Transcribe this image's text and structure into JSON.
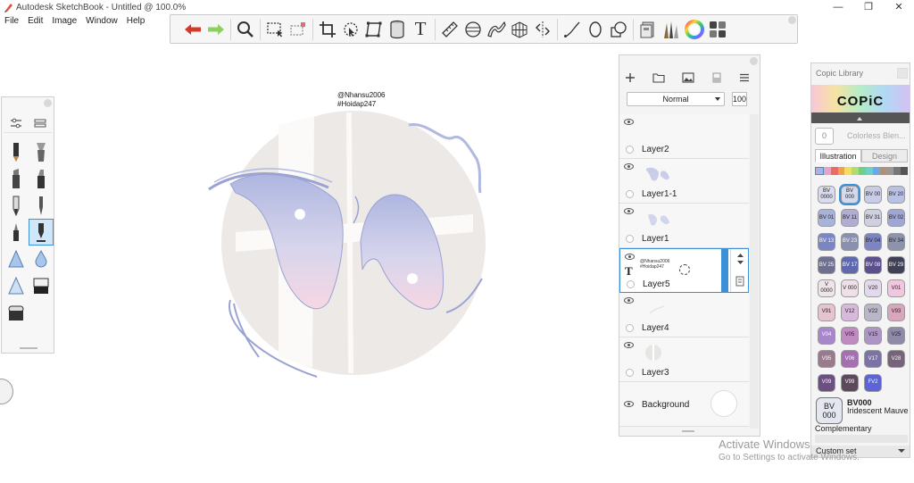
{
  "window": {
    "title": "Autodesk SketchBook - Untitled @ 100.0%",
    "minimize": "—",
    "maximize": "❐",
    "close": "✕"
  },
  "menu": [
    "File",
    "Edit",
    "Image",
    "Window",
    "Help"
  ],
  "toolbar": {
    "tools": [
      "undo-icon",
      "redo-icon",
      "zoom-icon",
      "select-icon",
      "crop-select-icon",
      "crop-icon",
      "lasso-icon",
      "perspective-icon",
      "cylinder-icon",
      "text-icon",
      "ruler-icon",
      "ellipse-guide-icon",
      "french-curve-icon",
      "perspective-grid-icon",
      "symmetry-icon",
      "stroke-icon",
      "circle-icon",
      "shape-icon",
      "copic-library-icon",
      "brush-library-icon",
      "color-wheel-icon",
      "layer-editor-icon"
    ],
    "text_glyph": "T"
  },
  "canvas": {
    "watermark_line1": "@Nhansu2006",
    "watermark_line2": "#Hoidap247"
  },
  "layers": {
    "blend_mode": "Normal",
    "opacity": "100",
    "items": [
      {
        "name": "Layer2"
      },
      {
        "name": "Layer1-1"
      },
      {
        "name": "Layer1"
      },
      {
        "name": "Layer5",
        "active": true,
        "text_line1": "@Nhansu2006",
        "text_line2": "#Hoidap247",
        "type_glyph": "T"
      },
      {
        "name": "Layer4"
      },
      {
        "name": "Layer3"
      },
      {
        "name": "Background"
      }
    ]
  },
  "copic": {
    "title": "Copic Library",
    "logo": "COPiC",
    "colorless_code": "0",
    "colorless_label": "Colorless Blen...",
    "tabs": [
      "Illustration",
      "Design"
    ],
    "swatches": [
      {
        "code": "BV 0000",
        "color": "#d9dcee"
      },
      {
        "code": "BV 000",
        "color": "#d5d9ec",
        "selected": true
      },
      {
        "code": "BV 00",
        "color": "#c9cce6"
      },
      {
        "code": "BV 20",
        "color": "#b9c2e4"
      },
      {
        "code": "BV 01",
        "color": "#a8b3dc"
      },
      {
        "code": "BV 11",
        "color": "#b0acd4"
      },
      {
        "code": "BV 31",
        "color": "#cfcfe2"
      },
      {
        "code": "BV 02",
        "color": "#9fa6d6"
      },
      {
        "code": "BV 13",
        "color": "#7b85c3"
      },
      {
        "code": "BV 23",
        "color": "#8a90b0"
      },
      {
        "code": "BV 04",
        "color": "#7d84c2"
      },
      {
        "code": "BV 34",
        "color": "#8e93ab"
      },
      {
        "code": "BV 25",
        "color": "#6f6f90"
      },
      {
        "code": "BV 17",
        "color": "#5f6aae"
      },
      {
        "code": "BV 08",
        "color": "#5b4f8e"
      },
      {
        "code": "BV 29",
        "color": "#3f3f55"
      },
      {
        "code": "V 0000",
        "color": "#efe4ea"
      },
      {
        "code": "V 000",
        "color": "#eedfe9"
      },
      {
        "code": "V20",
        "color": "#e3d9ec"
      },
      {
        "code": "V01",
        "color": "#f1c6df"
      },
      {
        "code": "V91",
        "color": "#e6c4cf"
      },
      {
        "code": "V12",
        "color": "#d8b8db"
      },
      {
        "code": "V22",
        "color": "#b9b6c7"
      },
      {
        "code": "V93",
        "color": "#d8a7bd"
      },
      {
        "code": "V04",
        "color": "#a986cc"
      },
      {
        "code": "V05",
        "color": "#c18ac3"
      },
      {
        "code": "V15",
        "color": "#ad96c6"
      },
      {
        "code": "V25",
        "color": "#8f8aa7"
      },
      {
        "code": "V95",
        "color": "#9a7a8d"
      },
      {
        "code": "V06",
        "color": "#a56fb2"
      },
      {
        "code": "V17",
        "color": "#7b72a6"
      },
      {
        "code": "V28",
        "color": "#76647a"
      },
      {
        "code": "V09",
        "color": "#6b4e82"
      },
      {
        "code": "V99",
        "color": "#5b4a5c"
      },
      {
        "code": "FV2",
        "color": "#5c64d6"
      }
    ],
    "selected_code": "BV000",
    "selected_swatch_label": "BV 000",
    "selected_name": "Iridescent Mauve",
    "complementary_label": "Complementary",
    "custom_set": "Custom set"
  },
  "activation": {
    "line1": "Activate Windows",
    "line2": "Go to Settings to activate Windows."
  },
  "colors": {
    "accent": "#3d8fd6",
    "undo": "#d43a2a",
    "redo": "#8fcf5e"
  }
}
